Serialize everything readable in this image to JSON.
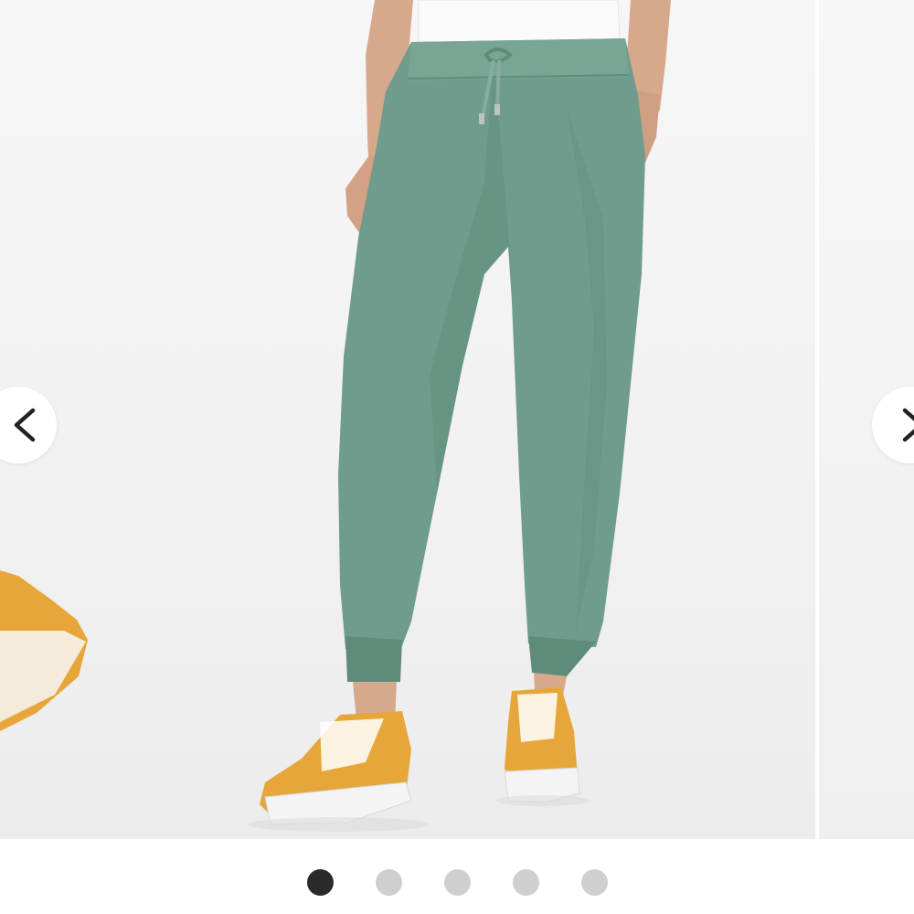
{
  "carousel": {
    "slide_count": 5,
    "active_index": 0,
    "current_image": {
      "subject": "jogger-pants-product-photo",
      "pants_color": "#6f9c8c",
      "shoe_color": "#e6a63a"
    },
    "prev_icon": "chevron-left-icon",
    "next_icon": "chevron-right-icon"
  },
  "colors": {
    "dot_active": "#2b2b2b",
    "dot_inactive": "#cfcfcf",
    "background": "#f3f3f3"
  }
}
